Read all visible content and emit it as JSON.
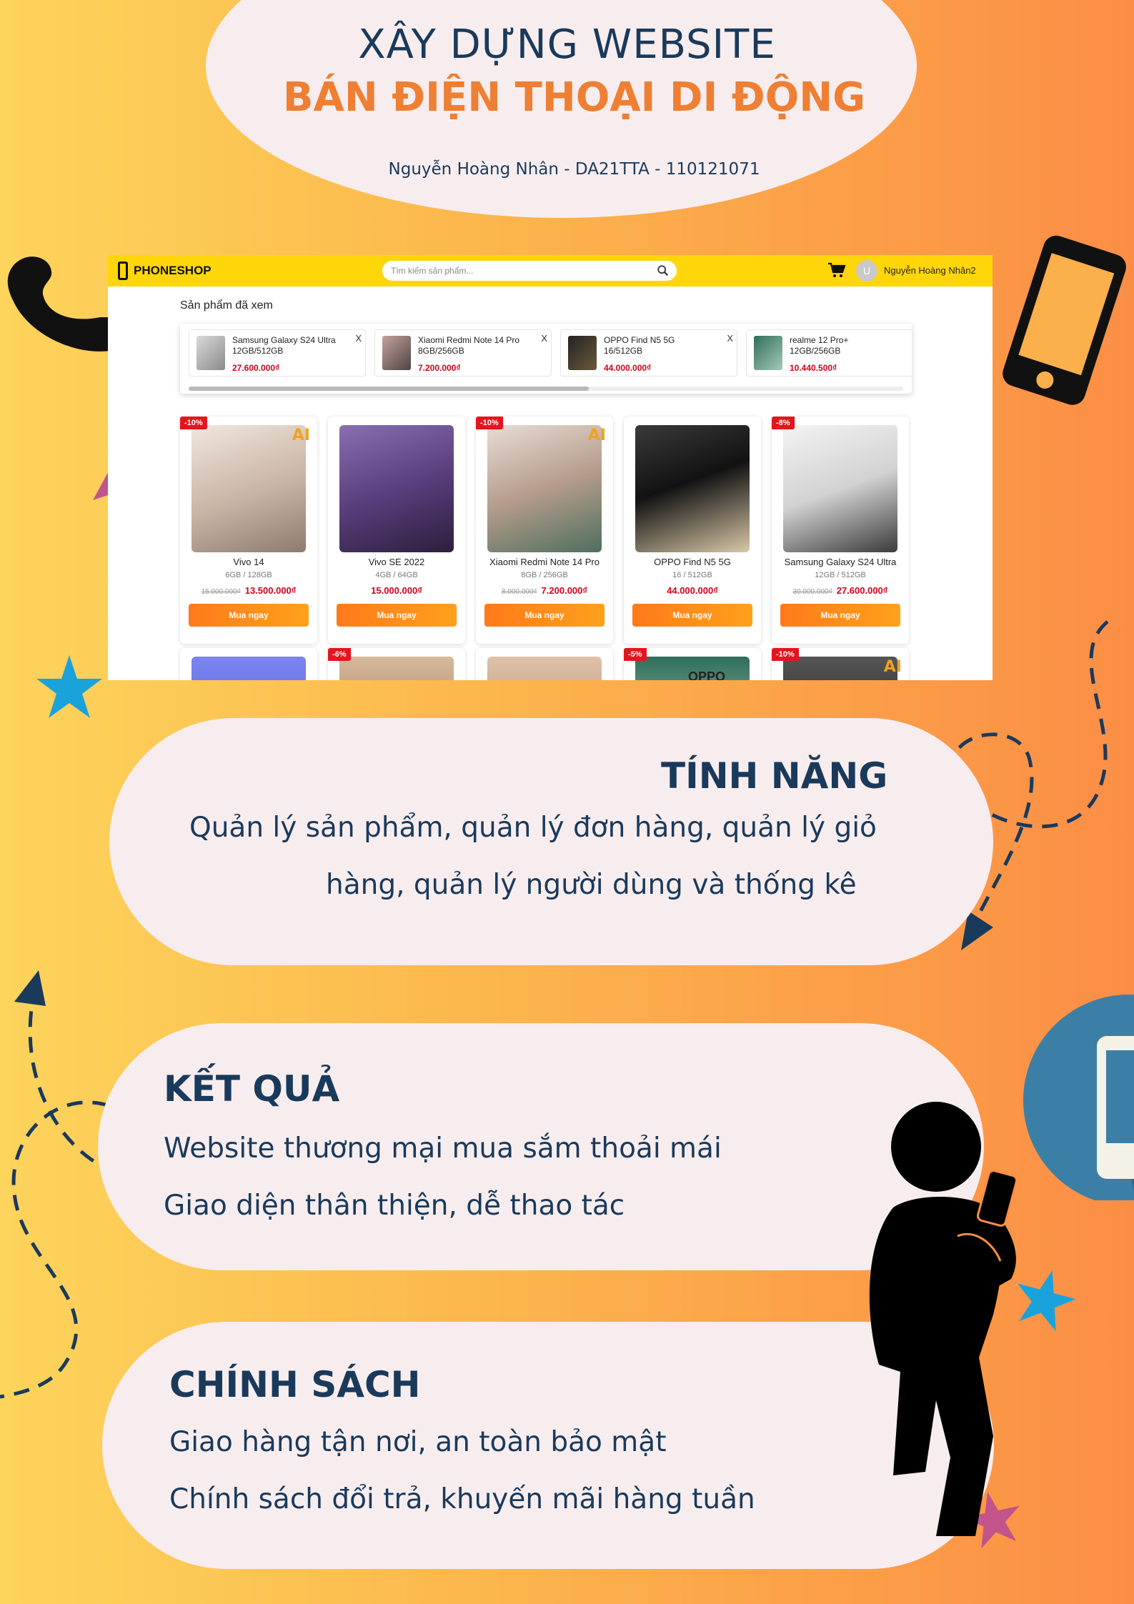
{
  "header": {
    "line1": "XÂY DỰNG WEBSITE",
    "line2": "BÁN ĐIỆN THOẠI DI ĐỘNG",
    "author": "Nguyễn Hoàng Nhân - DA21TTA - 110121071"
  },
  "shop": {
    "brand": "PHONESHOP",
    "search_placeholder": "Tìm kiếm sản phẩm...",
    "avatar_letter": "U",
    "username": "Nguyễn Hoàng Nhân2",
    "recently_viewed_title": "Sản phẩm đã xem",
    "recently_viewed": [
      {
        "name": "Samsung Galaxy S24 Ultra 12GB/512GB",
        "price": "27.600.000₫",
        "close": "X"
      },
      {
        "name": "Xiaomi Redmi Note 14 Pro 8GB/256GB",
        "price": "7.200.000₫",
        "close": "X"
      },
      {
        "name": "OPPO Find N5 5G 16/512GB",
        "price": "44.000.000₫",
        "close": "X"
      },
      {
        "name": "realme 12 Pro+ 12GB/256GB",
        "price": "10.440.500₫",
        "close": ""
      }
    ],
    "buy_label": "Mua ngay",
    "products": [
      {
        "name": "Vivo 14",
        "spec": "6GB / 128GB",
        "old_price": "15.000.000₫",
        "price": "13.500.000₫",
        "badge": "-10%",
        "ai": "AI"
      },
      {
        "name": "Vivo SE 2022",
        "spec": "4GB / 64GB",
        "old_price": "",
        "price": "15.000.000₫",
        "badge": "",
        "ai": ""
      },
      {
        "name": "Xiaomi Redmi Note 14 Pro",
        "spec": "8GB / 256GB",
        "old_price": "8.000.000₫",
        "price": "7.200.000₫",
        "badge": "-10%",
        "ai": "AI"
      },
      {
        "name": "OPPO Find N5 5G",
        "spec": "16 / 512GB",
        "old_price": "",
        "price": "44.000.000₫",
        "badge": "",
        "ai": ""
      },
      {
        "name": "Samsung Galaxy S24 Ultra",
        "spec": "12GB / 512GB",
        "old_price": "30.000.000₫",
        "price": "27.600.000₫",
        "badge": "-8%",
        "ai": ""
      }
    ],
    "row2_badges": [
      "",
      "-6%",
      "",
      "-5%",
      "-10%"
    ],
    "row2_ai": "AI",
    "row2_brand_text": "OPPO"
  },
  "features": {
    "title": "TÍNH NĂNG",
    "line1": "Quản lý sản phẩm, quản lý đơn hàng, quản lý giỏ",
    "line2": "hàng, quản lý người dùng và thống kê"
  },
  "results": {
    "title": "KẾT QUẢ",
    "line1": "Website thương mại mua sắm thoải mái",
    "line2": "Giao diện thân thiện, dễ thao tác"
  },
  "policy": {
    "title": "CHÍNH SÁCH",
    "line1": "Giao hàng tận nơi, an toàn bảo mật",
    "line2": "Chính sách đổi trả, khuyến mãi hàng tuần"
  },
  "colors": {
    "navy": "#1a3a5c",
    "orange": "#ee7f33",
    "shop_yellow": "#ffd60a",
    "price_red": "#d0021b"
  }
}
